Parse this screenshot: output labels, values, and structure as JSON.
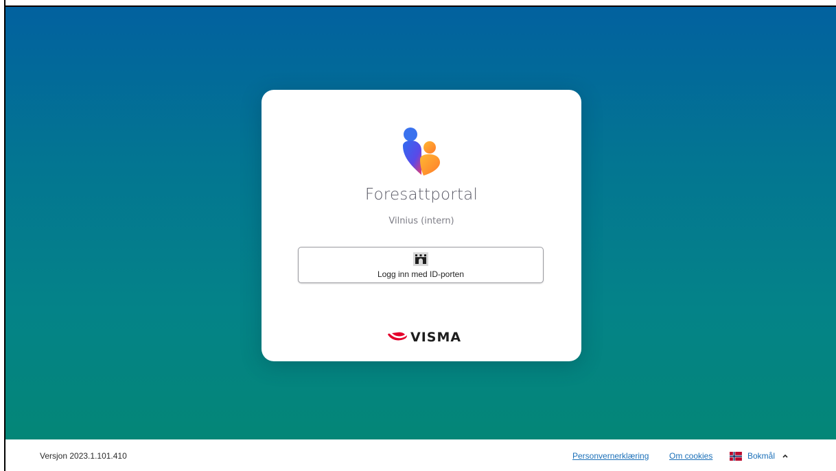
{
  "app": {
    "title": "Foresattportal",
    "subtitle": "Vilnius (intern)"
  },
  "login": {
    "button_label": "Logg inn med ID-porten",
    "icon": "id-porten-icon"
  },
  "brand": {
    "name": "VISMA",
    "accent_color": "#e4002b"
  },
  "footer": {
    "version": "Versjon 2023.1.101.410",
    "privacy_link": "Personvernerklæring",
    "cookies_link": "Om cookies",
    "language": "Bokmål",
    "language_icon": "norway-flag-icon",
    "language_chevron": "chevron-up-icon"
  },
  "colors": {
    "background_top": "#02619f",
    "background_bottom": "#048677",
    "link": "#1a6fb8"
  }
}
